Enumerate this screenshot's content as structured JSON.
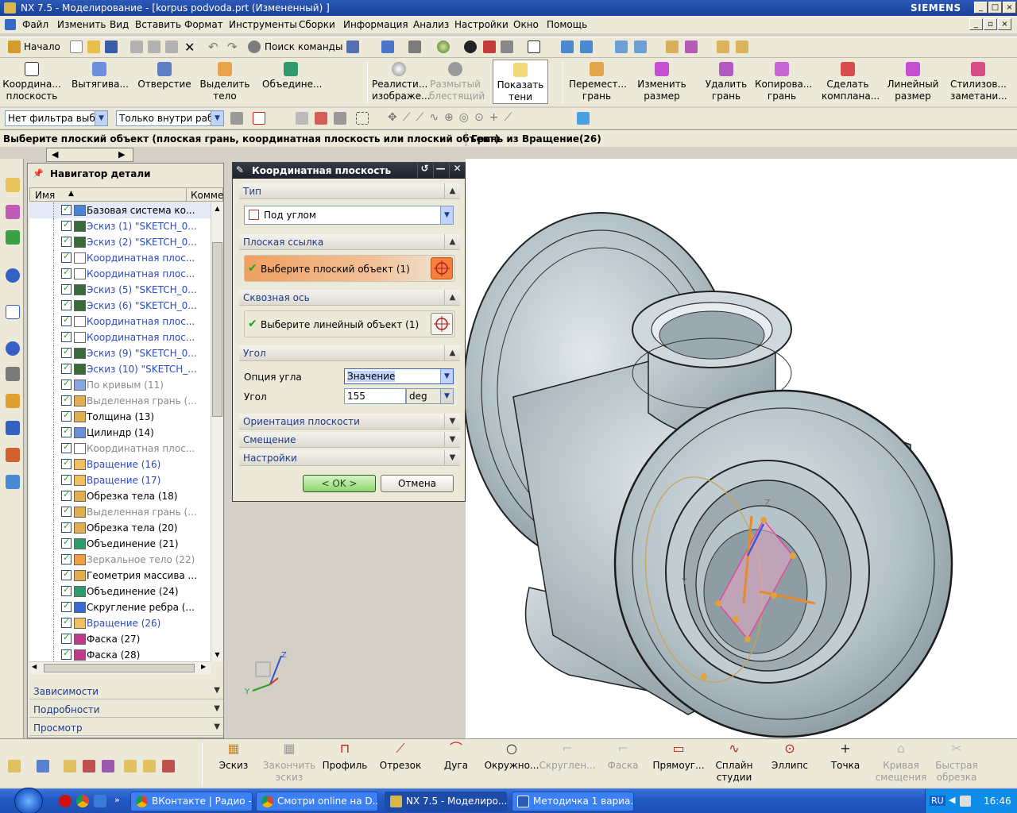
{
  "window": {
    "title": "NX 7.5 - Моделирование - [korpus podvoda.prt (Измененный) ]",
    "brand": "SIEMENS"
  },
  "menu": [
    "Файл",
    "Изменить",
    "Вид",
    "Вставить",
    "Формат",
    "Инструменты",
    "Сборки",
    "Информация",
    "Анализ",
    "Настройки",
    "Окно",
    "Помощь"
  ],
  "toolbar1": {
    "start": "Начало",
    "command_finder": "Поиск команды"
  },
  "bigtoolbar": {
    "group1": [
      {
        "label": "Координа... плоскость",
        "icon": "datum-plane-icon"
      },
      {
        "label": "Вытягива...",
        "icon": "extrude-icon"
      },
      {
        "label": "Отверстие",
        "icon": "hole-icon"
      },
      {
        "label": "Выделить тело",
        "icon": "extract-body-icon"
      },
      {
        "label": "Объедине...",
        "icon": "unite-icon"
      }
    ],
    "group2": [
      {
        "label": "Реалисти... изображе...",
        "icon": "realistic-shading-icon",
        "disabled": false
      },
      {
        "label": "Размытый блестящий",
        "icon": "blurred-glossy-icon",
        "disabled": true
      },
      {
        "label": "Показать тени",
        "icon": "show-shadows-icon",
        "disabled": false
      }
    ],
    "group3": [
      {
        "label": "Перемест... грань",
        "icon": "move-face-icon"
      },
      {
        "label": "Изменить размер",
        "icon": "resize-icon"
      },
      {
        "label": "Удалить грань",
        "icon": "delete-face-icon"
      },
      {
        "label": "Копирова... грань",
        "icon": "copy-face-icon"
      },
      {
        "label": "Сделать компланa...",
        "icon": "make-coplanar-icon"
      },
      {
        "label": "Линейный размер",
        "icon": "linear-dimension-icon"
      },
      {
        "label": "Стилизов... заметани...",
        "icon": "styled-sweep-icon"
      }
    ]
  },
  "filters": {
    "type_filter": "Нет фильтра выбор",
    "scope_filter": "Только внутри рабо"
  },
  "cue": {
    "prompt": "Выберите плоский объект (плоская грань, координатная плоскость или плоский объект)",
    "status": "Грань из Вращение(26)"
  },
  "navigator": {
    "title": "Навигатор детали",
    "col_name": "Имя",
    "col_comment": "Комме",
    "items": [
      {
        "label": "Базовая система ко...",
        "color": "#000000"
      },
      {
        "label": "Эскиз (1) \"SKETCH_0...",
        "color": "#2b49c4"
      },
      {
        "label": "Эскиз (2) \"SKETCH_0...",
        "color": "#2b49c4"
      },
      {
        "label": "Координатная плос...",
        "color": "#2b49c4"
      },
      {
        "label": "Координатная плос...",
        "color": "#2b49c4"
      },
      {
        "label": "Эскиз (5) \"SKETCH_0...",
        "color": "#2b49c4"
      },
      {
        "label": "Эскиз (6) \"SKETCH_0...",
        "color": "#2b49c4"
      },
      {
        "label": "Координатная плос...",
        "color": "#2b49c4"
      },
      {
        "label": "Координатная плос...",
        "color": "#2b49c4"
      },
      {
        "label": "Эскиз (9) \"SKETCH_0...",
        "color": "#2b49c4"
      },
      {
        "label": "Эскиз (10) \"SKETCH_...",
        "color": "#2b49c4"
      },
      {
        "label": "По кривым (11)",
        "color": "#8a8a8a"
      },
      {
        "label": "Выделенная грань (...",
        "color": "#8a8a8a"
      },
      {
        "label": "Толщина (13)",
        "color": "#000000"
      },
      {
        "label": "Цилиндр (14)",
        "color": "#000000"
      },
      {
        "label": "Координатная плос...",
        "color": "#8a8a8a"
      },
      {
        "label": "Вращение (16)",
        "color": "#2b49c4"
      },
      {
        "label": "Вращение (17)",
        "color": "#2b49c4"
      },
      {
        "label": "Обрезка тела (18)",
        "color": "#000000"
      },
      {
        "label": "Выделенная грань (...",
        "color": "#8a8a8a"
      },
      {
        "label": "Обрезка тела (20)",
        "color": "#000000"
      },
      {
        "label": "Объединение (21)",
        "color": "#000000"
      },
      {
        "label": "Зеркальное тело (22)",
        "color": "#8a8a8a"
      },
      {
        "label": "Геометрия массива ...",
        "color": "#000000"
      },
      {
        "label": "Объединение (24)",
        "color": "#000000"
      },
      {
        "label": "Скругление ребра (...",
        "color": "#000000"
      },
      {
        "label": "Вращение (26)",
        "color": "#2b49c4"
      },
      {
        "label": "Фаска (27)",
        "color": "#000000"
      },
      {
        "label": "Фаска (28)",
        "color": "#000000"
      }
    ],
    "panels": [
      "Зависимости",
      "Подробности",
      "Просмотр"
    ]
  },
  "dialog": {
    "title": "Координатная плоскость",
    "type_section": "Тип",
    "type_value": "Под углом",
    "plane_ref_section": "Плоская ссылка",
    "plane_ref_select": "Выберите плоский объект (1)",
    "axis_section": "Сквозная ось",
    "axis_select": "Выберите линейный объект (1)",
    "angle_section": "Угол",
    "angle_option_label": "Опция угла",
    "angle_option_value": "Значение",
    "angle_label": "Угол",
    "angle_value": "155",
    "angle_unit": "deg",
    "orientation_section": "Ориентация плоскости",
    "offset_section": "Смещение",
    "settings_section": "Настройки",
    "ok": "< OK >",
    "cancel": "Отмена"
  },
  "bottomtoolbar": [
    {
      "label": "Эскиз",
      "disabled": false
    },
    {
      "label": "Закончить эскиз",
      "disabled": true
    },
    {
      "label": "Профиль",
      "disabled": false
    },
    {
      "label": "Отрезок",
      "disabled": false
    },
    {
      "label": "Дуга",
      "disabled": false
    },
    {
      "label": "Окружно...",
      "disabled": false
    },
    {
      "label": "Скруглен...",
      "disabled": true
    },
    {
      "label": "Фаска",
      "disabled": true
    },
    {
      "label": "Прямоуг...",
      "disabled": false
    },
    {
      "label": "Сплайн студии",
      "disabled": false
    },
    {
      "label": "Эллипс",
      "disabled": false
    },
    {
      "label": "Точка",
      "disabled": false
    },
    {
      "label": "Кривая смещения",
      "disabled": true
    },
    {
      "label": "Быстрая обрезка",
      "disabled": true
    }
  ],
  "taskbar": {
    "tasks": [
      "ВКонтакте | Радио -...",
      "Смотри online на D...",
      "NX 7.5 - Моделиро...",
      "Методичка 1 вариа..."
    ],
    "lang": "RU",
    "clock": "16:46"
  },
  "axes": {
    "x": "X",
    "y": "Y",
    "z": "Z"
  }
}
